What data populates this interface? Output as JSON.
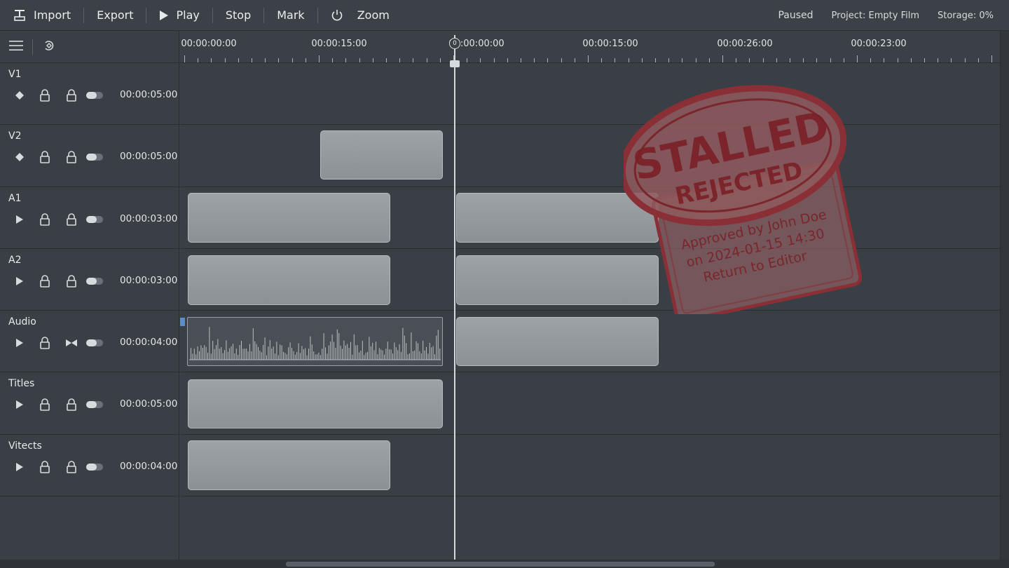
{
  "toolbar": {
    "import_label": "Import",
    "export_label": "Export",
    "play_label": "Play",
    "stop_label": "Stop",
    "mark_label": "Mark",
    "zoom_label": "Zoom"
  },
  "status": {
    "state": "Paused",
    "project": "Project: Empty Film",
    "storage": "Storage: 0%"
  },
  "ruler": {
    "labels": [
      "00:00:00:00",
      "00:00:15:00",
      "00:00:00:00",
      "00:00:15:00",
      "00:00:26:00",
      "00:00:23:00"
    ],
    "playhead_marker": "0"
  },
  "tracks": [
    {
      "name": "V1",
      "duration": "00:00:05:00",
      "kind": "video"
    },
    {
      "name": "V2",
      "duration": "00:00:05:00",
      "kind": "video"
    },
    {
      "name": "A1",
      "duration": "00:00:03:00",
      "kind": "audio"
    },
    {
      "name": "A2",
      "duration": "00:00:03:00",
      "kind": "audio"
    },
    {
      "name": "Audio",
      "duration": "00:00:04:00",
      "kind": "audio"
    },
    {
      "name": "Titles",
      "duration": "00:00:05:00",
      "kind": "audio"
    },
    {
      "name": "Vitects",
      "duration": "00:00:04:00",
      "kind": "audio"
    }
  ],
  "stamp": {
    "main": "STALLED",
    "sub": "REJECTED",
    "line1": "Approved by John Doe",
    "line2": "on 2024-01-15 14:30",
    "line3": "Return to Editor",
    "color": "#8a2f35"
  },
  "icons": {
    "import": "import-icon",
    "play": "play-icon",
    "zoom": "zoom-icon",
    "menu": "hamburger-icon",
    "snap": "snap-icon"
  }
}
